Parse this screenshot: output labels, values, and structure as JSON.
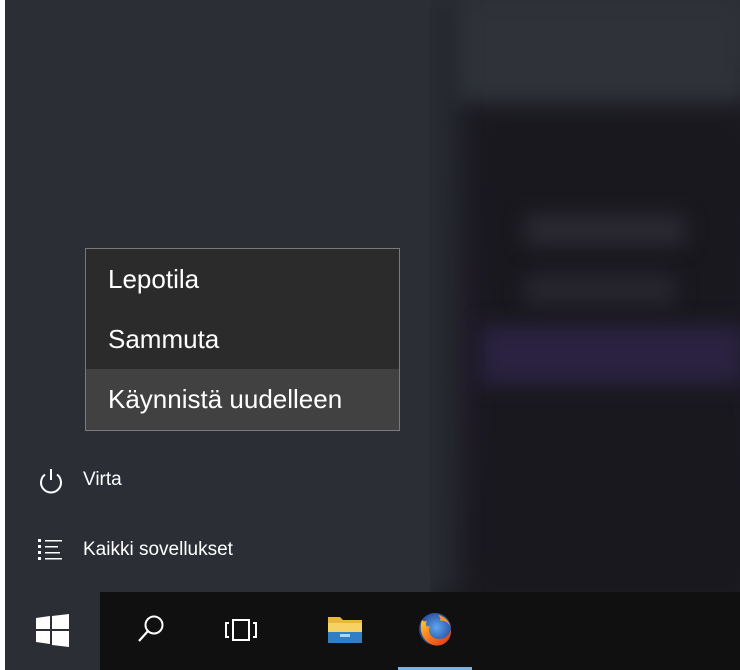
{
  "power_menu": {
    "items": [
      {
        "label": "Lepotila"
      },
      {
        "label": "Sammuta"
      },
      {
        "label": "Käynnistä uudelleen",
        "highlighted": true
      }
    ]
  },
  "start_menu": {
    "power_label": "Virta",
    "power_icon": "power-icon",
    "all_apps_label": "Kaikki sovellukset",
    "all_apps_icon": "list-icon"
  },
  "taskbar": {
    "items": [
      {
        "name": "start",
        "icon": "windows-logo-icon"
      },
      {
        "name": "search",
        "icon": "search-icon"
      },
      {
        "name": "task-view",
        "icon": "task-view-icon"
      },
      {
        "name": "file-explorer",
        "icon": "folder-icon"
      },
      {
        "name": "firefox",
        "icon": "firefox-icon",
        "active": true
      }
    ]
  },
  "colors": {
    "menu_bg": "#2b2f35",
    "flyout_bg": "#2b2b2b",
    "flyout_highlight": "#414141",
    "taskbar_bg": "#101010",
    "accent": "#7eb3e0"
  }
}
